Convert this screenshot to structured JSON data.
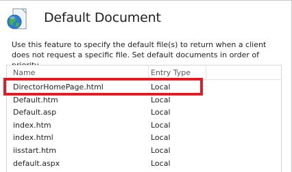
{
  "header": {
    "title": "Default Document",
    "icon": "globe-document-icon"
  },
  "description": "Use this feature to specify the default file(s) to return when a client does not request a specific file. Set default documents in order of priority.",
  "list": {
    "columns": {
      "name": "Name",
      "entry_type": "Entry Type"
    },
    "rows": [
      {
        "name": "DirectorHomePage.html",
        "entry_type": "Local"
      },
      {
        "name": "Default.htm",
        "entry_type": "Local"
      },
      {
        "name": "Default.asp",
        "entry_type": "Local"
      },
      {
        "name": "index.htm",
        "entry_type": "Local"
      },
      {
        "name": "index.html",
        "entry_type": "Local"
      },
      {
        "name": "iisstart.htm",
        "entry_type": "Local"
      },
      {
        "name": "default.aspx",
        "entry_type": "Local"
      }
    ]
  },
  "colors": {
    "highlight": "#d8202b"
  }
}
